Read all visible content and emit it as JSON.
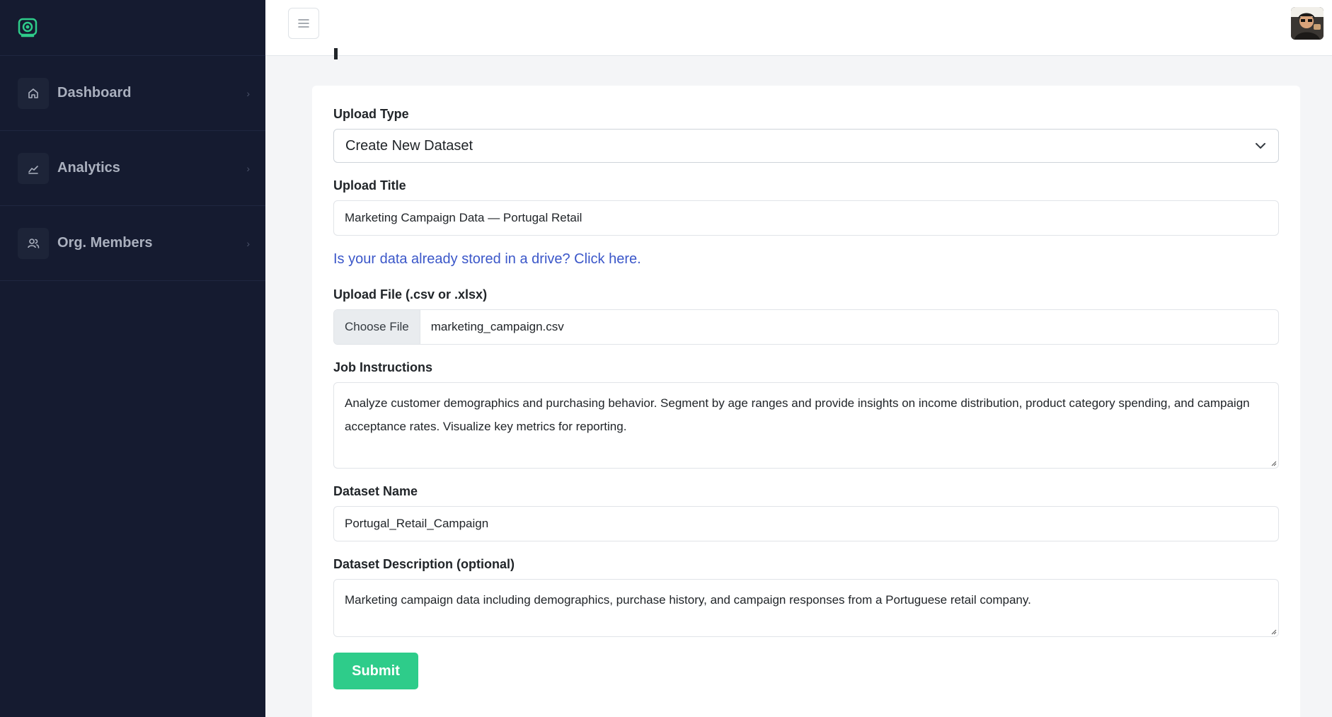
{
  "sidebar": {
    "logo_icon": "app-logo-icon",
    "items": [
      {
        "label": "Dashboard",
        "icon": "home-icon"
      },
      {
        "label": "Analytics",
        "icon": "chart-line-icon"
      },
      {
        "label": "Org. Members",
        "icon": "users-icon"
      }
    ]
  },
  "topbar": {
    "menu_icon": "hamburger-icon",
    "avatar": "user-avatar"
  },
  "form": {
    "upload_type_label": "Upload Type",
    "upload_type_value": "Create New Dataset",
    "upload_title_label": "Upload Title",
    "upload_title_value": "Marketing Campaign Data — Portugal Retail",
    "drive_link": "Is your data already stored in a drive? Click here.",
    "upload_file_label": "Upload File (.csv or .xlsx)",
    "choose_file_label": "Choose File",
    "file_name": "marketing_campaign.csv",
    "job_instructions_label": "Job Instructions",
    "job_instructions_value": "Analyze customer demographics and purchasing behavior. Segment by age ranges and provide insights on income distribution, product category spending, and campaign acceptance rates. Visualize key metrics for reporting.",
    "dataset_name_label": "Dataset Name",
    "dataset_name_value": "Portugal_Retail_Campaign",
    "dataset_description_label": "Dataset Description (optional)",
    "dataset_description_value": "Marketing campaign data including demographics, purchase history, and campaign responses from a Portuguese retail company.",
    "submit_label": "Submit"
  },
  "colors": {
    "sidebar_bg": "#151b30",
    "accent_green": "#2ecc8a",
    "link_blue": "#3b57c9"
  }
}
